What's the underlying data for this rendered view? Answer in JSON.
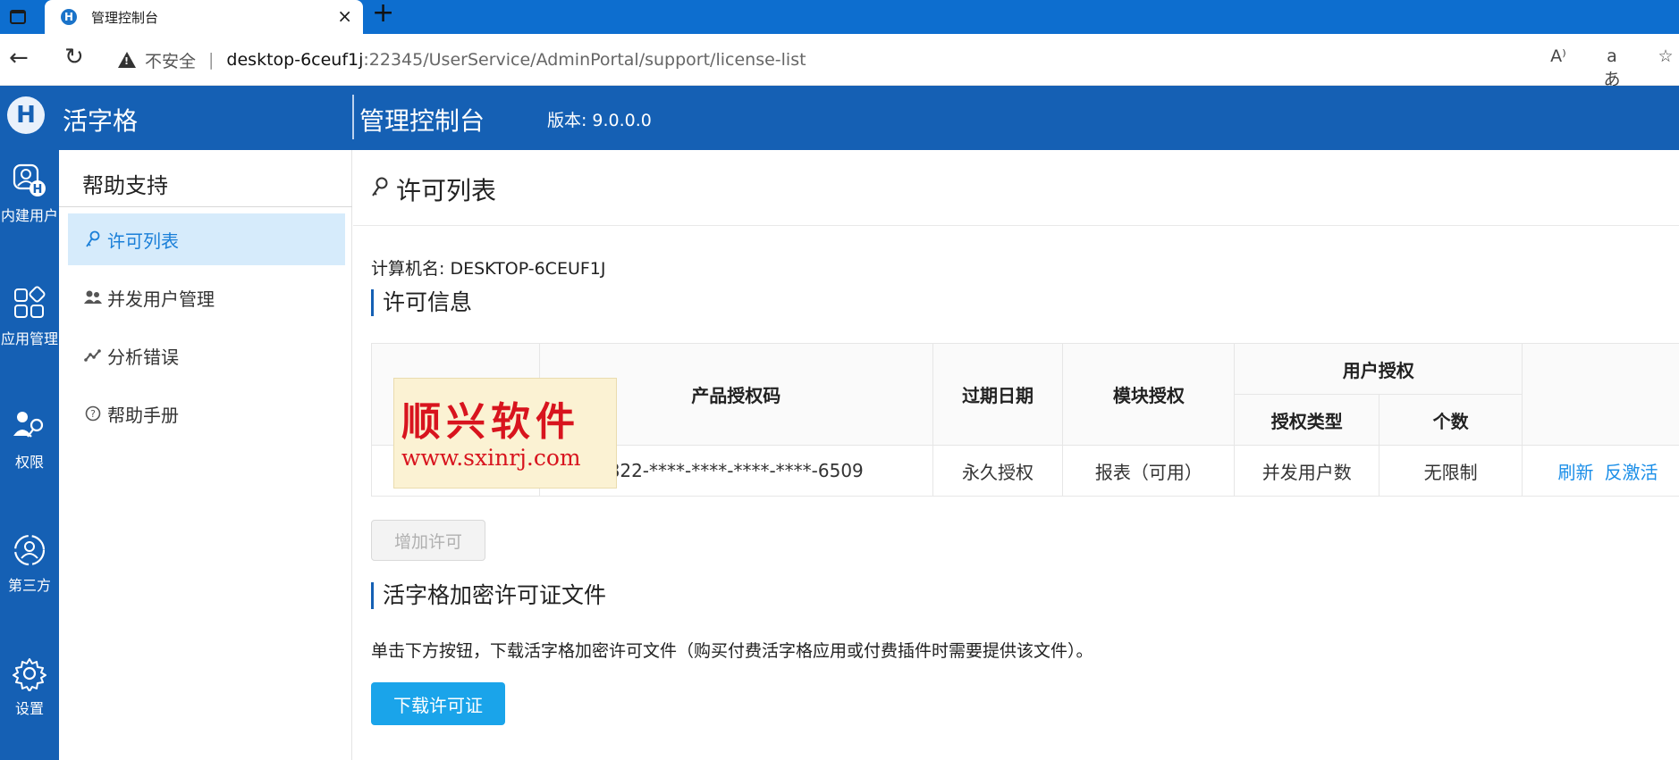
{
  "browser": {
    "tab_title": "管理控制台",
    "tab_favicon": "H",
    "close_glyph": "×",
    "new_tab_glyph": "+",
    "insecure_label": "不安全",
    "url_host": "desktop-6ceuf1j",
    "url_rest": ":22345/UserService/AdminPortal/support/license-list",
    "toolbar": [
      "A⁾",
      "aあ",
      "☆"
    ]
  },
  "header": {
    "logo_letter": "H",
    "brand": "活字格",
    "console_title": "管理控制台",
    "version_label": "版本:",
    "version_value": "9.0.0.0"
  },
  "rail": [
    {
      "label": "内建用户",
      "icon": "built-in-user-icon"
    },
    {
      "label": "应用管理",
      "icon": "app-grid-icon"
    },
    {
      "label": "权限",
      "icon": "permission-key-icon"
    },
    {
      "label": "第三方",
      "icon": "third-party-icon"
    },
    {
      "label": "设置",
      "icon": "gear-icon"
    }
  ],
  "sidebar": {
    "title": "帮助支持",
    "items": [
      {
        "label": "许可列表",
        "icon": "key-icon",
        "active": true
      },
      {
        "label": "并发用户管理",
        "icon": "users-icon",
        "active": false
      },
      {
        "label": "分析错误",
        "icon": "line-chart-icon",
        "active": false
      },
      {
        "label": "帮助手册",
        "icon": "help-circle-icon",
        "active": false
      }
    ]
  },
  "main": {
    "page_title": "许可列表",
    "machine_label": "计算机名:",
    "machine_value": "DESKTOP-6CEUF1J",
    "license_section": "许可信息",
    "table": {
      "headers": {
        "code": "产品授权码",
        "expiry": "过期日期",
        "module": "模块授权",
        "user_auth": "用户授权",
        "auth_type": "授权类型",
        "count": "个数"
      },
      "row": {
        "code": "822-****-****-****-****-6509",
        "expiry": "永久授权",
        "module": "报表（可用）",
        "auth_type": "并发用户数",
        "count": "无限制",
        "refresh": "刷新",
        "deactivate": "反激活"
      }
    },
    "add_button": "增加许可",
    "encrypt_section": "活字格加密许可证文件",
    "description": "单击下方按钮，下载活字格加密许可文件（购买付费活字格应用或付费插件时需要提供该文件）。",
    "download_button": "下载许可证"
  },
  "watermark": {
    "cn": "顺兴软件",
    "url": "www.sxinrj.com"
  },
  "colors": {
    "header_blue": "#1560b4",
    "tab_blue": "#0d6ecf",
    "active_bg": "#d6ebfb",
    "link": "#1a8ee8",
    "primary_btn": "#1aa4ea"
  }
}
